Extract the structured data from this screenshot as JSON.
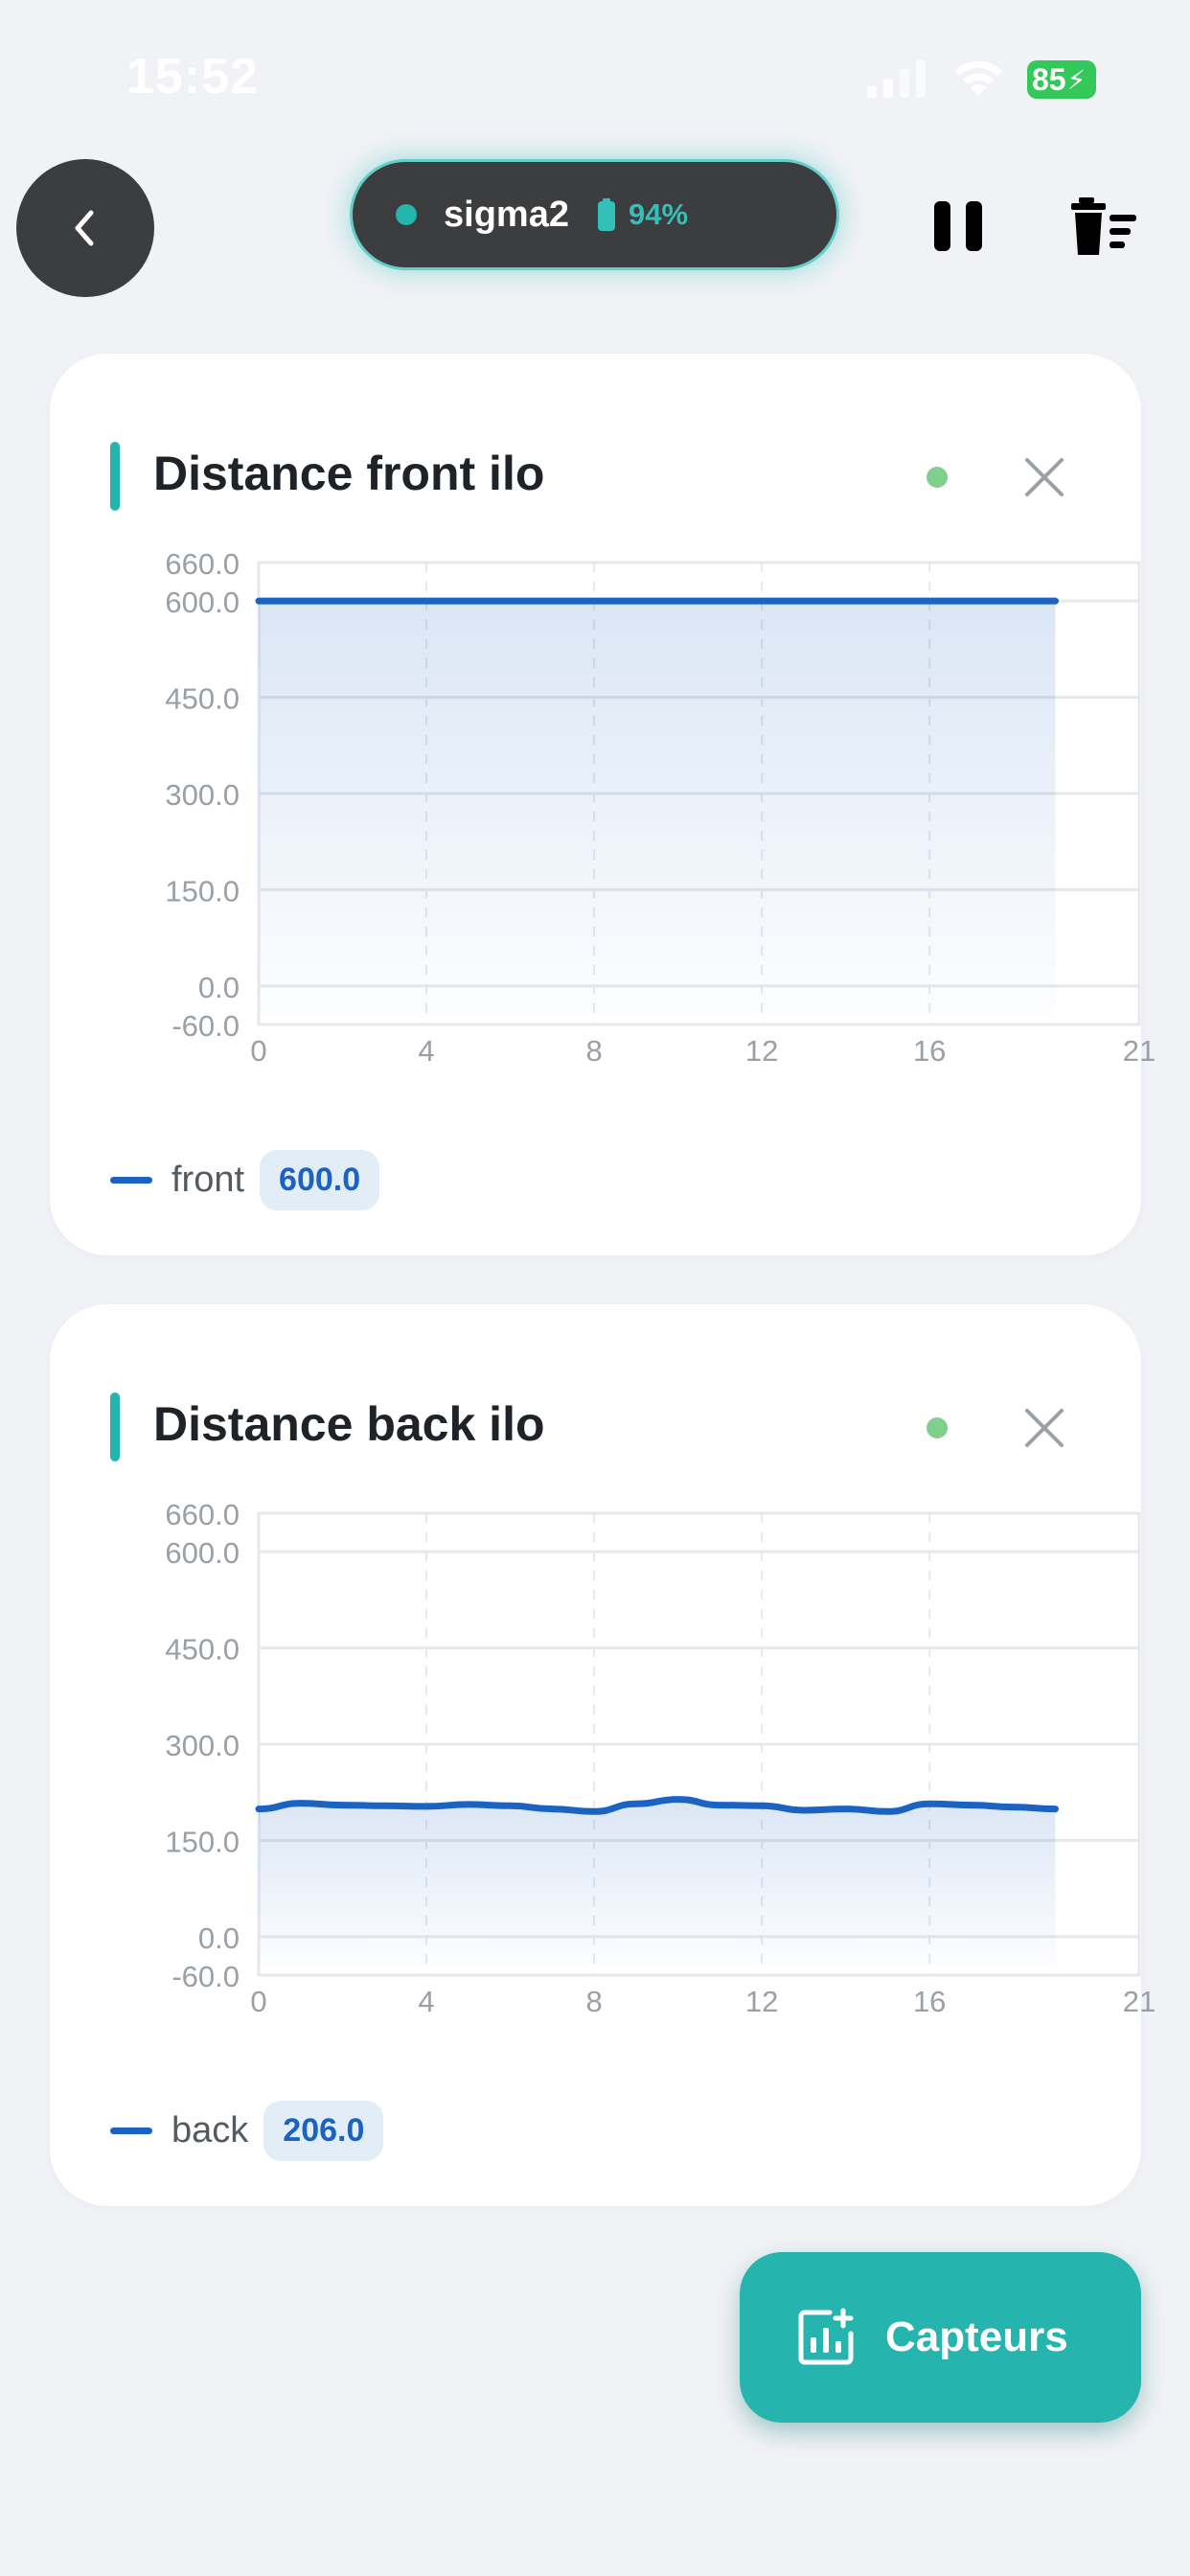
{
  "status_bar": {
    "time": "15:52",
    "battery": "85"
  },
  "header": {
    "device_name": "sigma2",
    "device_battery": "94%"
  },
  "charts": [
    {
      "title": "Distance front ilo",
      "legend": {
        "label": "front",
        "value": "600.0"
      },
      "chart_data": {
        "type": "area",
        "title": "Distance front ilo",
        "ylim": [
          -60,
          660
        ],
        "y_ticks": [
          "660.0",
          "600.0",
          "450.0",
          "300.0",
          "150.0",
          "0.0",
          "-60.0"
        ],
        "x_ticks": [
          "0",
          "4",
          "8",
          "12",
          "16",
          "21"
        ],
        "xlim": [
          0,
          21
        ],
        "series": [
          {
            "name": "front",
            "x": [
              0,
              1,
              2,
              3,
              4,
              5,
              6,
              7,
              8,
              9,
              10,
              11,
              12,
              13,
              14,
              15,
              16,
              17,
              18,
              19
            ],
            "values": [
              600,
              600,
              600,
              600,
              600,
              600,
              600,
              600,
              600,
              600,
              600,
              600,
              600,
              600,
              600,
              600,
              600,
              600,
              600,
              600
            ]
          }
        ],
        "grid": true,
        "color": "#1b63c2"
      }
    },
    {
      "title": "Distance back ilo",
      "legend": {
        "label": "back",
        "value": "206.0"
      },
      "chart_data": {
        "type": "area",
        "title": "Distance back ilo",
        "ylim": [
          -60,
          660
        ],
        "y_ticks": [
          "660.0",
          "600.0",
          "450.0",
          "300.0",
          "150.0",
          "0.0",
          "-60.0"
        ],
        "x_ticks": [
          "0",
          "4",
          "8",
          "12",
          "16",
          "21"
        ],
        "xlim": [
          0,
          21
        ],
        "series": [
          {
            "name": "back",
            "x": [
              0,
              1,
              2,
              3,
              4,
              5,
              6,
              7,
              8,
              9,
              10,
              11,
              12,
              13,
              14,
              15,
              16,
              17,
              18,
              19
            ],
            "values": [
              199,
              208,
              205,
              204,
              203,
              206,
              204,
              199,
              195,
              207,
              214,
              205,
              204,
              197,
              199,
              195,
              207,
              205,
              202,
              199
            ]
          }
        ],
        "grid": true,
        "color": "#1b63c2"
      }
    }
  ],
  "fab": {
    "label": "Capteurs"
  },
  "icons": {
    "back": "chevron-left-icon",
    "pause": "pause-icon",
    "trash": "trash-list-icon",
    "close": "close-icon",
    "sensors": "chart-add-icon"
  }
}
